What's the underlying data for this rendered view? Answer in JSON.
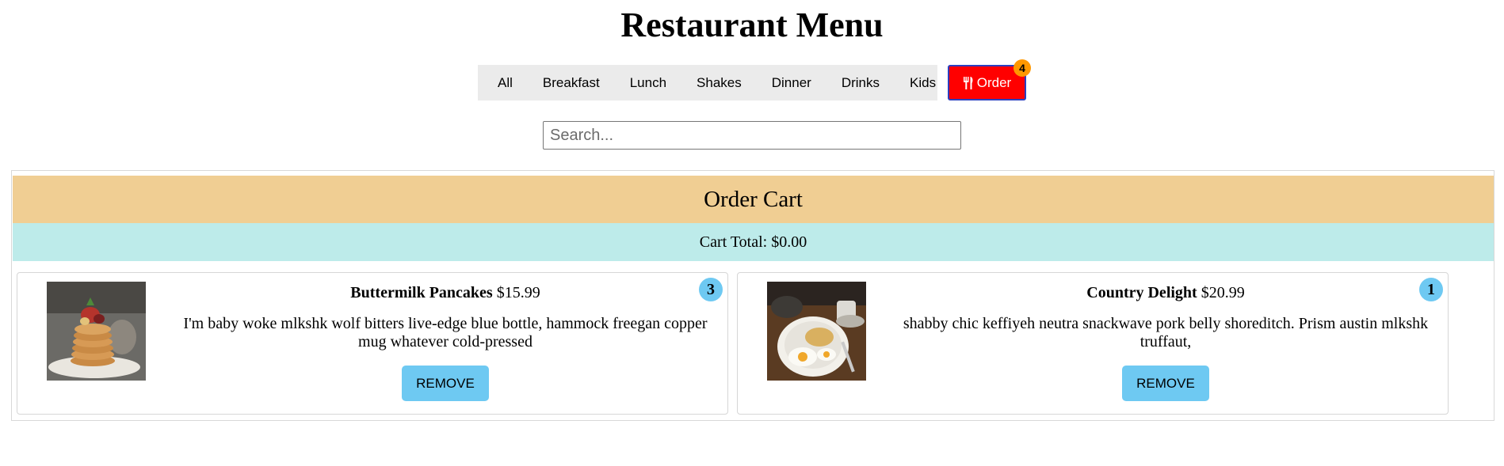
{
  "page_title": "Restaurant Menu",
  "nav": {
    "items": [
      {
        "label": "All"
      },
      {
        "label": "Breakfast"
      },
      {
        "label": "Lunch"
      },
      {
        "label": "Shakes"
      },
      {
        "label": "Dinner"
      },
      {
        "label": "Drinks"
      },
      {
        "label": "Kids"
      }
    ],
    "order_button": {
      "label": "Order",
      "icon": "fork-knife-icon",
      "badge_count": "4",
      "color": "#ff0000"
    }
  },
  "search": {
    "placeholder": "Search...",
    "value": ""
  },
  "cart": {
    "header": "Order Cart",
    "total_text": "Cart Total: $0.00",
    "items": [
      {
        "name": "Buttermilk Pancakes",
        "price": "$15.99",
        "description": "I'm baby woke mlkshk wolf bitters live-edge blue bottle, hammock freegan copper mug whatever cold-pressed",
        "quantity": "3",
        "remove_label": "REMOVE",
        "image": "pancakes-photo"
      },
      {
        "name": "Country Delight",
        "price": "$20.99",
        "description": "shabby chic keffiyeh neutra snackwave pork belly shoreditch. Prism austin mlkshk truffaut,",
        "quantity": "1",
        "remove_label": "REMOVE",
        "image": "breakfast-plate-photo"
      }
    ]
  },
  "colors": {
    "cart_header_bg": "#f0ce93",
    "cart_total_bg": "#bdebea",
    "accent_blue": "#6ec9f2",
    "badge_orange": "#ff9800"
  }
}
